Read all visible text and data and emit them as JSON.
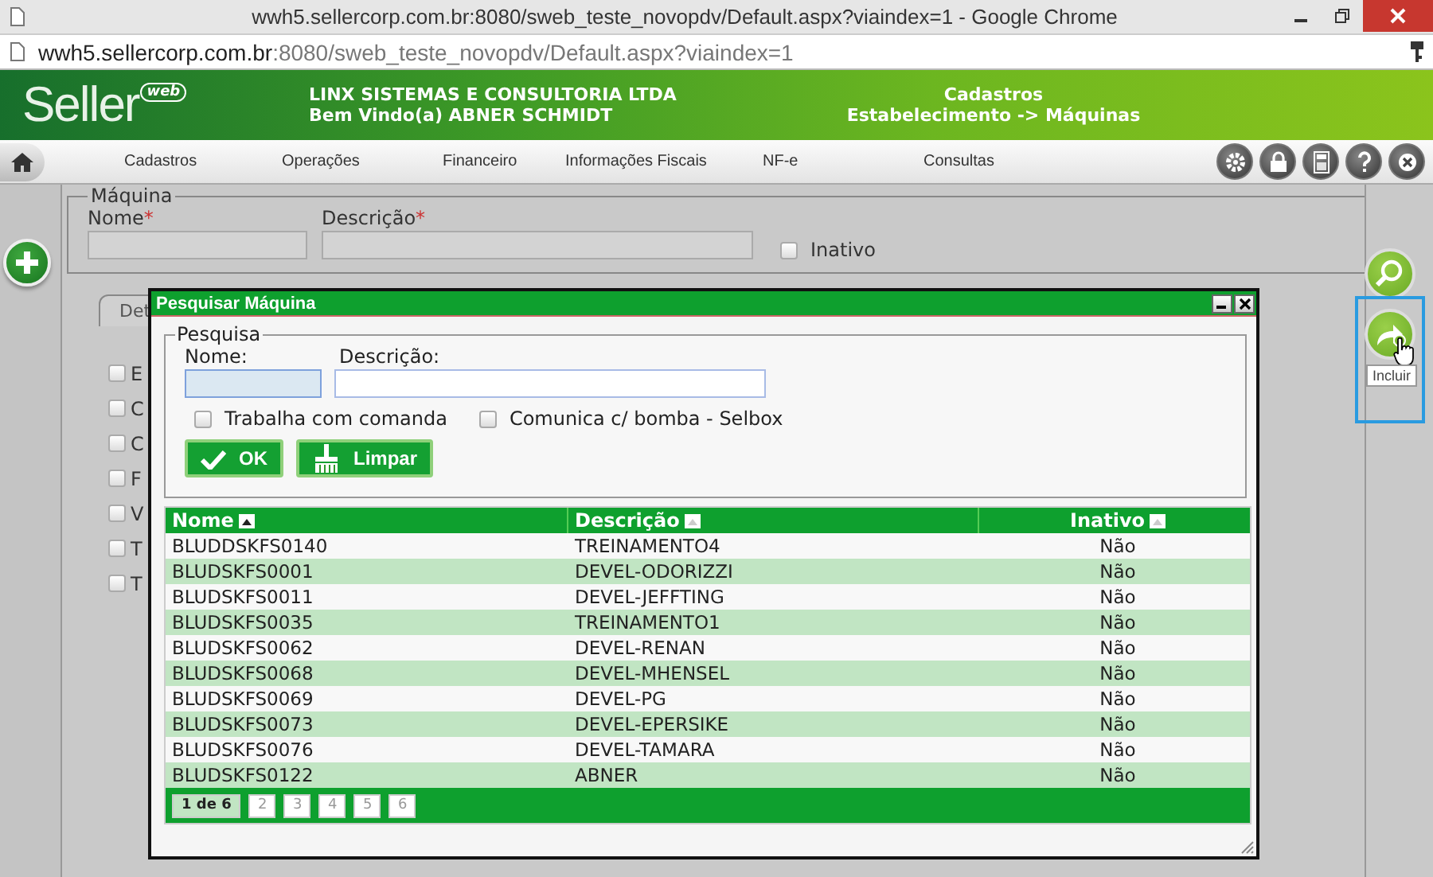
{
  "browser": {
    "title": "wwh5.sellercorp.com.br:8080/sweb_teste_novopdv/Default.aspx?viaindex=1 - Google Chrome",
    "url_host": "wwh5.sellercorp.com.br",
    "url_path": ":8080/sweb_teste_novopdv/Default.aspx?viaindex=1"
  },
  "header": {
    "logo": "Seller",
    "logo_badge": "web",
    "company": "LINX SISTEMAS E CONSULTORIA LTDA",
    "welcome": "Bem Vindo(a) ABNER SCHMIDT",
    "module": "Cadastros",
    "breadcrumb": "Estabelecimento -> Máquinas"
  },
  "menu": [
    "Cadastros",
    "Operações",
    "Financeiro",
    "Informações Fiscais",
    "NF-e",
    "Consultas"
  ],
  "form": {
    "legend": "Máquina",
    "fields": [
      {
        "label": "Nome",
        "marker": "*"
      },
      {
        "label": "Descrição",
        "marker": "*"
      }
    ],
    "inativo": {
      "label": "Inativo",
      "checked": false
    },
    "tab": "Det",
    "options": [
      {
        "label": "E",
        "checked": false
      },
      {
        "label": "C",
        "checked": false
      },
      {
        "label": "C",
        "checked": false
      },
      {
        "label": "F",
        "checked": false
      },
      {
        "label": "V",
        "checked": false
      },
      {
        "label": "T",
        "checked": false
      },
      {
        "label": "T",
        "checked": false
      }
    ]
  },
  "side_buttons": [
    {
      "kind": "search",
      "hovered": false
    },
    {
      "kind": "include",
      "hovered": true,
      "tooltip": "Incluir"
    }
  ],
  "dialog": {
    "title": "Pesquisar Máquina",
    "legend": "Pesquisa",
    "fields": [
      {
        "label": "Nome:",
        "focused": true
      },
      {
        "label": "Descrição:",
        "focused": false
      }
    ],
    "checks": [
      {
        "label": "Trabalha com comanda",
        "checked": false
      },
      {
        "label": "Comunica c/ bomba - Selbox",
        "checked": false
      }
    ],
    "buttons": [
      {
        "kind": "ok",
        "label": "OK"
      },
      {
        "kind": "clear",
        "label": "Limpar"
      }
    ],
    "table": {
      "columns": [
        "Nome",
        "Descrição",
        "Inativo"
      ],
      "rows": [
        [
          "BLUDDSKFS0140",
          "TREINAMENTO4",
          "Não"
        ],
        [
          "BLUDSKFS0001",
          "DEVEL-ODORIZZI",
          "Não"
        ],
        [
          "BLUDSKFS0011",
          "DEVEL-JEFFTING",
          "Não"
        ],
        [
          "BLUDSKFS0035",
          "TREINAMENTO1",
          "Não"
        ],
        [
          "BLUDSKFS0062",
          "DEVEL-RENAN",
          "Não"
        ],
        [
          "BLUDSKFS0068",
          "DEVEL-MHENSEL",
          "Não"
        ],
        [
          "BLUDSKFS0069",
          "DEVEL-PG",
          "Não"
        ],
        [
          "BLUDSKFS0073",
          "DEVEL-EPERSIKE",
          "Não"
        ],
        [
          "BLUDSKFS0076",
          "DEVEL-TAMARA",
          "Não"
        ],
        [
          "BLUDSKFS0122",
          "ABNER",
          "Não"
        ]
      ]
    },
    "pages": [
      {
        "label": "1 de 6",
        "selected": true
      },
      {
        "label": "2",
        "selected": false
      },
      {
        "label": "3",
        "selected": false
      },
      {
        "label": "4",
        "selected": false
      },
      {
        "label": "5",
        "selected": false
      },
      {
        "label": "6",
        "selected": false
      }
    ]
  }
}
